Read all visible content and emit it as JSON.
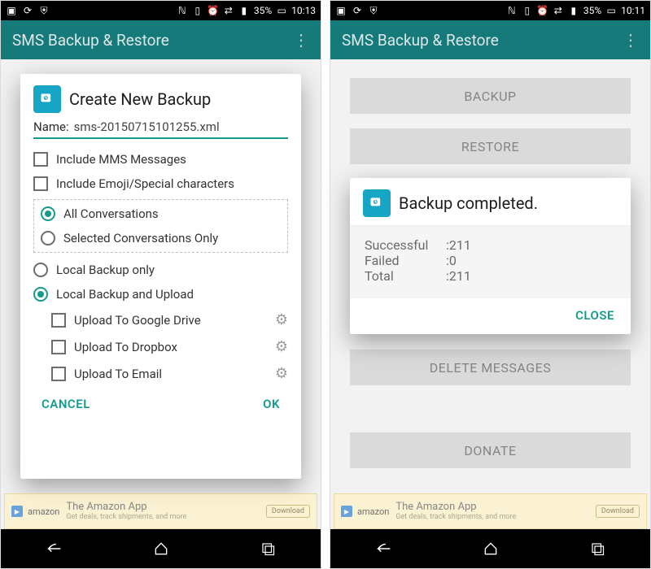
{
  "left": {
    "status": {
      "battery": "35%",
      "time": "10:13"
    },
    "appbar_title": "SMS Backup & Restore",
    "dialog": {
      "title": "Create New Backup",
      "name_label": "Name:",
      "name_value": "sms-20150715101255.xml",
      "chk_mms": "Include MMS Messages",
      "chk_emoji": "Include Emoji/Special characters",
      "rad_all": "All Conversations",
      "rad_sel": "Selected Conversations Only",
      "rad_local": "Local Backup only",
      "rad_upload": "Local Backup and Upload",
      "up_gdrive": "Upload To Google Drive",
      "up_dropbox": "Upload To Dropbox",
      "up_email": "Upload To Email",
      "cancel": "CANCEL",
      "ok": "OK"
    },
    "ad": {
      "brand": "amazon",
      "title": "The Amazon App",
      "sub": "Get deals, track shipments, and more",
      "dl": "Download"
    }
  },
  "right": {
    "status": {
      "battery": "35%",
      "time": "10:11"
    },
    "appbar_title": "SMS Backup & Restore",
    "bg": {
      "backup": "BACKUP",
      "restore": "RESTORE",
      "delete": "DELETE MESSAGES",
      "donate": "DONATE"
    },
    "dialog": {
      "title": "Backup completed.",
      "k_success": "Successful",
      "v_success": "211",
      "k_failed": "Failed",
      "v_failed": "0",
      "k_total": "Total",
      "v_total": "211",
      "close": "CLOSE"
    },
    "ad": {
      "brand": "amazon",
      "title": "The Amazon App",
      "sub": "Get deals, track shipments, and more",
      "dl": "Download"
    }
  }
}
